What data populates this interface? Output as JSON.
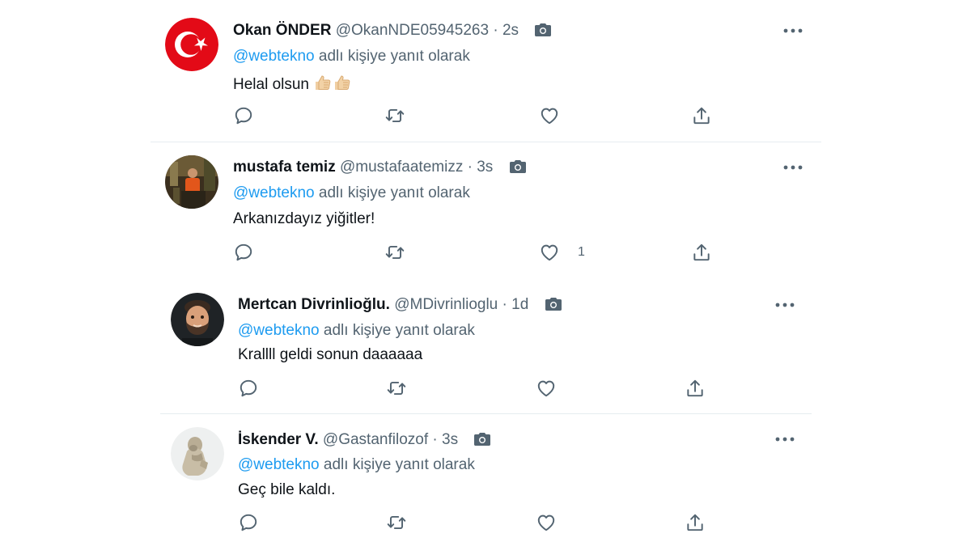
{
  "tweets": [
    {
      "name": "Okan ÖNDER",
      "handle": "@OkanNDE05945263",
      "separator": "·",
      "time": "2s",
      "reply_mention": "@webtekno",
      "reply_suffix": "adlı kişiye yanıt olarak",
      "text": "Helal olsun",
      "emoji": "thumbs-up-icon x2",
      "like_count": ""
    },
    {
      "name": "mustafa temiz",
      "handle": "@mustafaatemizz",
      "separator": "·",
      "time": "3s",
      "reply_mention": "@webtekno",
      "reply_suffix": "adlı kişiye yanıt olarak",
      "text": "Arkanızdayız yiğitler!",
      "like_count": "1"
    },
    {
      "name": "Mertcan Divrinlioğlu.",
      "handle": "@MDivrinlioglu",
      "separator": "·",
      "time": "1d",
      "reply_mention": "@webtekno",
      "reply_suffix": "adlı kişiye yanıt olarak",
      "text": "Krallll geldi sonun daaaaaa",
      "like_count": ""
    },
    {
      "name": "İskender V.",
      "handle": "@Gastanfilozof",
      "separator": "·",
      "time": "3s",
      "reply_mention": "@webtekno",
      "reply_suffix": "adlı kişiye yanıt olarak",
      "text": "Geç bile kaldı.",
      "like_count": ""
    }
  ],
  "colors": {
    "mention": "#1d9bf0",
    "secondary_text": "#536471",
    "primary_text": "#0f1419",
    "divider": "#e6ecf0",
    "flag_red": "#e30a17"
  },
  "icons": [
    "camera-icon",
    "more-icon",
    "reply-icon",
    "retweet-icon",
    "like-icon",
    "share-icon",
    "thumbs-up-icon"
  ]
}
